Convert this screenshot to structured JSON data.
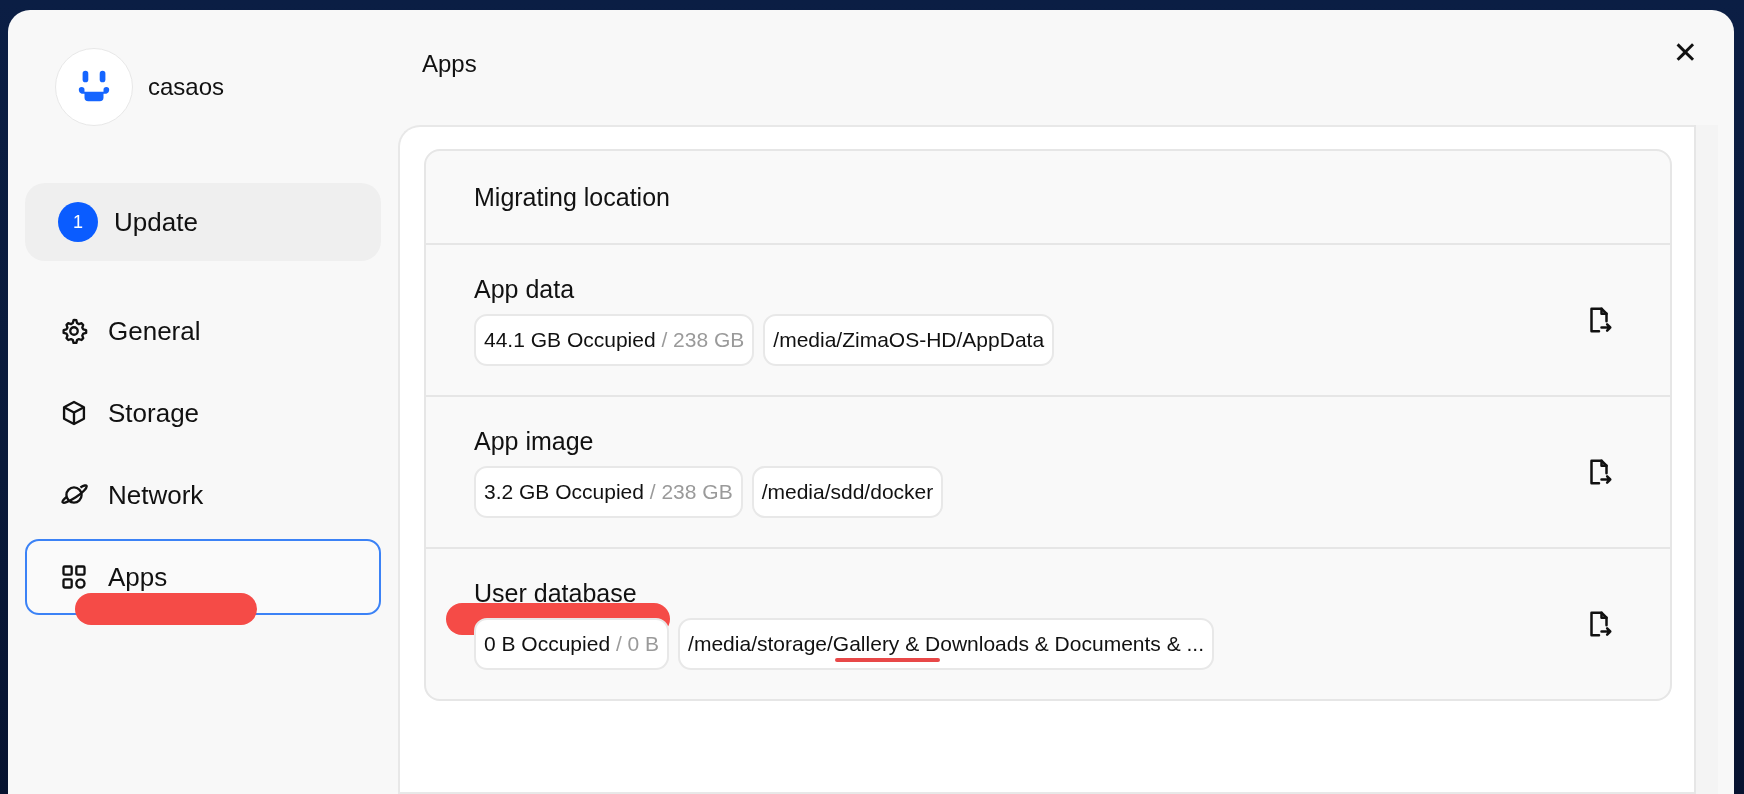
{
  "user": {
    "name": "casaos"
  },
  "sidebar": {
    "update": {
      "badge": "1",
      "label": "Update"
    },
    "items": [
      {
        "label": "General",
        "selected": false,
        "scribbled": false
      },
      {
        "label": "Storage",
        "selected": false,
        "scribbled": false
      },
      {
        "label": "Network",
        "selected": false,
        "scribbled": false
      },
      {
        "label": "Apps",
        "selected": true,
        "scribbled": true
      }
    ]
  },
  "main": {
    "title": "Apps",
    "close": "✕",
    "card": {
      "title": "Migrating location",
      "entries": [
        {
          "label": "App data",
          "scribbled": false,
          "occupied": "44.1 GB Occupied",
          "total": "/ 238 GB",
          "path": "/media/ZimaOS-HD/AppData",
          "path_underlined": false
        },
        {
          "label": "App image",
          "scribbled": false,
          "occupied": "3.2 GB Occupied",
          "total": "/ 238 GB",
          "path": "/media/sdd/docker",
          "path_underlined": false
        },
        {
          "label": "User database",
          "scribbled": true,
          "occupied": "0 B Occupied",
          "total": "/ 0 B",
          "path": "/media/storage/Gallery & Downloads & Documents & ...",
          "path_underlined": true
        }
      ]
    }
  }
}
